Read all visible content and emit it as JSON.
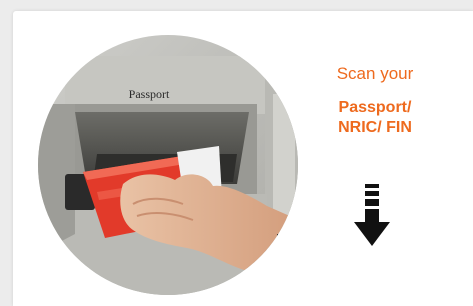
{
  "scan_prompt": {
    "line1": "Scan your",
    "line2": "Passport/",
    "line3": "NRIC/ FIN"
  },
  "kiosk": {
    "slot_label": "Passport"
  },
  "icons": {
    "photo": "passport-scanner-photo",
    "arrow": "arrow-down-icon"
  },
  "colors": {
    "accent": "#ee6a1e",
    "background": "#ececec",
    "card": "#ffffff"
  }
}
